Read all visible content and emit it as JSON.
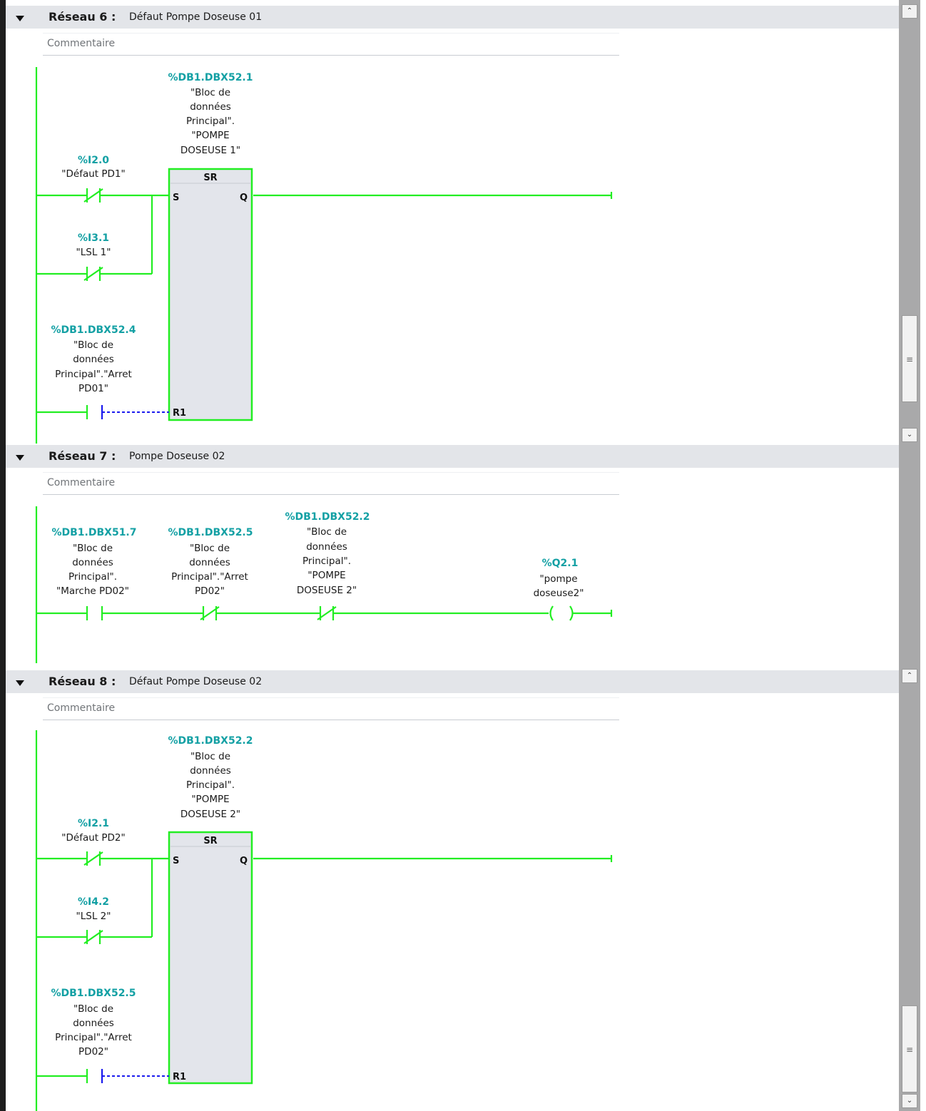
{
  "comment_placeholder": "Commentaire",
  "networks": [
    {
      "title": "Réseau 6 :",
      "subtitle": "Défaut Pompe Doseuse 01",
      "block": {
        "type": "SR",
        "pin_s": "S",
        "pin_q": "Q",
        "pin_r": "R1",
        "addr": "%DB1.DBX52.1",
        "label": [
          "\"Bloc de",
          "données",
          "Principal\".",
          "\"POMPE",
          "DOSEUSE 1\""
        ]
      },
      "contacts": [
        {
          "addr": "%I2.0",
          "label": [
            "\"Défaut PD1\""
          ],
          "type": "NC"
        },
        {
          "addr": "%I3.1",
          "label": [
            "\"LSL 1\""
          ],
          "type": "NC"
        },
        {
          "addr": "%DB1.DBX52.4",
          "label": [
            "\"Bloc de",
            "données",
            "Principal\".\"Arret",
            "PD01\""
          ],
          "type": "NO"
        }
      ]
    },
    {
      "title": "Réseau 7 :",
      "subtitle": "Pompe Doseuse 02",
      "contacts": [
        {
          "addr": "%DB1.DBX51.7",
          "label": [
            "\"Bloc de",
            "données",
            "Principal\".",
            "\"Marche PD02\""
          ],
          "type": "NO"
        },
        {
          "addr": "%DB1.DBX52.5",
          "label": [
            "\"Bloc de",
            "données",
            "Principal\".\"Arret",
            "PD02\""
          ],
          "type": "NC"
        },
        {
          "addr": "%DB1.DBX52.2",
          "label": [
            "\"Bloc de",
            "données",
            "Principal\".",
            "\"POMPE",
            "DOSEUSE 2\""
          ],
          "type": "NC"
        }
      ],
      "coil": {
        "addr": "%Q2.1",
        "label": [
          "\"pompe",
          "doseuse2\""
        ]
      }
    },
    {
      "title": "Réseau 8 :",
      "subtitle": "Défaut Pompe Doseuse 02",
      "block": {
        "type": "SR",
        "pin_s": "S",
        "pin_q": "Q",
        "pin_r": "R1",
        "addr": "%DB1.DBX52.2",
        "label": [
          "\"Bloc de",
          "données",
          "Principal\".",
          "\"POMPE",
          "DOSEUSE 2\""
        ]
      },
      "contacts": [
        {
          "addr": "%I2.1",
          "label": [
            "\"Défaut PD2\""
          ],
          "type": "NC"
        },
        {
          "addr": "%I4.2",
          "label": [
            "\"LSL 2\""
          ],
          "type": "NC"
        },
        {
          "addr": "%DB1.DBX52.5",
          "label": [
            "\"Bloc de",
            "données",
            "Principal\".\"Arret",
            "PD02\""
          ],
          "type": "NO"
        }
      ]
    }
  ],
  "scrollbar": {
    "up_glyph": "⌃",
    "down_glyph": "⌄",
    "grip_glyph": "≡"
  },
  "colors": {
    "wire": "#22ee22",
    "address": "#13a0a4",
    "pending": "#1a1aee",
    "header": "#e3e5e9"
  }
}
